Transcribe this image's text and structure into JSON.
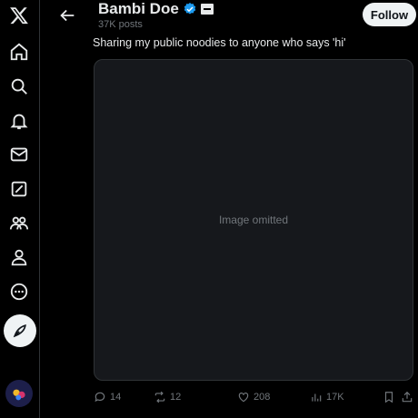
{
  "sidebar": {
    "items": [
      {
        "icon": "x-logo-icon"
      },
      {
        "icon": "home-icon"
      },
      {
        "icon": "search-icon"
      },
      {
        "icon": "bell-icon"
      },
      {
        "icon": "mail-icon"
      },
      {
        "icon": "grok-icon"
      },
      {
        "icon": "communities-icon"
      },
      {
        "icon": "profile-icon"
      },
      {
        "icon": "more-icon"
      },
      {
        "icon": "post-compose-icon"
      }
    ]
  },
  "header": {
    "name": "Bambi Doe",
    "post_count": "37K posts",
    "follow_label": "Follow"
  },
  "tweet": {
    "text": "Sharing my public noodies to anyone who says 'hi'",
    "media_note": "Image omitted",
    "stats": {
      "replies": "14",
      "reposts": "12",
      "likes": "208",
      "views": "17K"
    }
  },
  "colors": {
    "background": "#000000",
    "text": "#e7e9ea",
    "muted": "#71767b",
    "verified": "#1d9bf0",
    "button_bg": "#eff3f4"
  }
}
